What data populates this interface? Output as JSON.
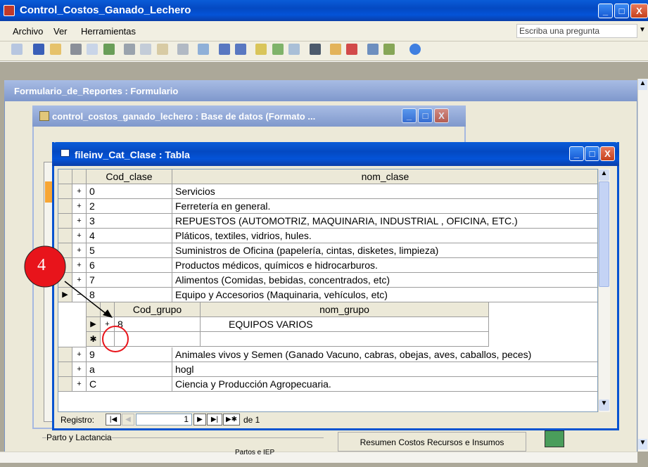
{
  "app": {
    "title": "Control_Costos_Ganado_Lechero",
    "min": "_",
    "max": "□",
    "close": "X"
  },
  "menu": {
    "items": [
      "Archivo",
      "Ver",
      "Herramientas"
    ],
    "help_placeholder": "Escriba una pregunta"
  },
  "mdi": {
    "form_title": "Formulario_de_Reportes : Formulario",
    "db_title": "control_costos_ganado_lechero : Base de datos (Formato ..."
  },
  "table": {
    "title": "fileinv_Cat_Clase : Tabla",
    "headers": [
      "Cod_clase",
      "nom_clase"
    ],
    "rows": [
      {
        "exp": "+",
        "code": "0",
        "name": "Servicios"
      },
      {
        "exp": "+",
        "code": "2",
        "name": "Ferretería en general."
      },
      {
        "exp": "+",
        "code": "3",
        "name": "REPUESTOS (AUTOMOTRIZ, MAQUINARIA, INDUSTRIAL , OFICINA, ETC.)"
      },
      {
        "exp": "+",
        "code": "4",
        "name": "Pláticos, textiles, vidrios, hules."
      },
      {
        "exp": "+",
        "code": "5",
        "name": "Suministros de Oficina (papelería, cintas, disketes, limpieza)"
      },
      {
        "exp": "+",
        "code": "6",
        "name": "Productos médicos, químicos e hidrocarburos."
      },
      {
        "exp": "+",
        "code": "7",
        "name": "Alimentos (Comidas, bebidas, concentrados, etc)"
      },
      {
        "exp": "−",
        "code": "8",
        "name": "Equipo y Accesorios (Maquinaria, vehículos, etc)"
      }
    ],
    "sub": {
      "headers": [
        "Cod_grupo",
        "nom_grupo"
      ],
      "rows": [
        {
          "exp": "+",
          "code": "8",
          "name": "EQUIPOS VARIOS"
        }
      ],
      "new_marker": "✱"
    },
    "rows_after": [
      {
        "exp": "+",
        "code": "9",
        "name": "Animales vivos y Semen (Ganado Vacuno, cabras, obejas, aves, caballos, peces)"
      },
      {
        "exp": "+",
        "code": "a",
        "name": "hogl"
      },
      {
        "exp": "+",
        "code": "C",
        "name": "Ciencia y Producción Agropecuaria."
      }
    ],
    "nav": {
      "label": "Registro:",
      "current": "1",
      "total_label": "de 1"
    }
  },
  "annotation": {
    "number": "4",
    "color": "#e8141b"
  },
  "background": {
    "left_label": "Parto y Lactancia",
    "right_label": "Resumen Costos Recursos e Insumos",
    "partial_label": "Partos e IEP"
  },
  "colors": {
    "title_blue": "#0450d1",
    "window_gray": "#ece9d8"
  }
}
